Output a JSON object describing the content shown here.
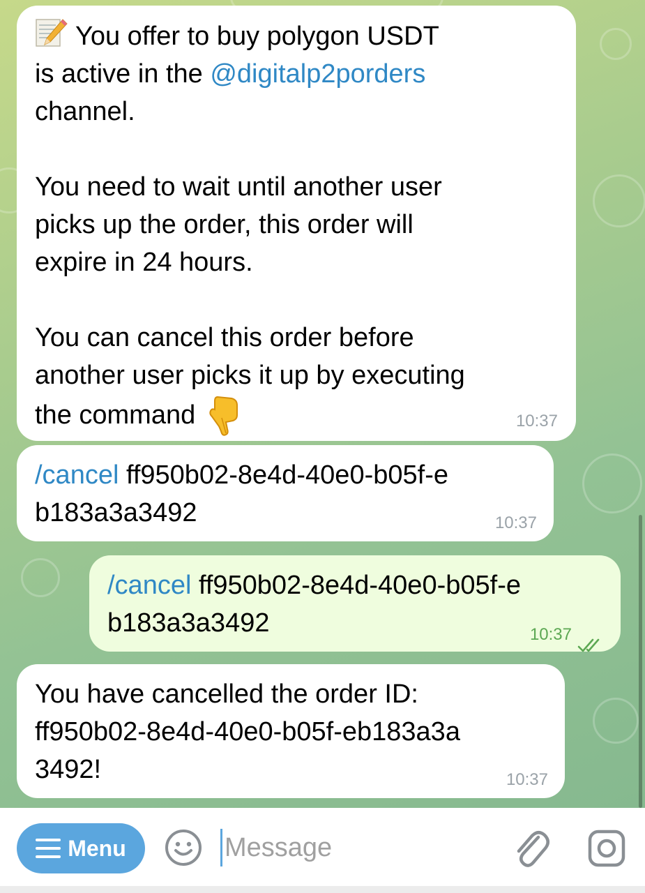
{
  "messages": [
    {
      "direction": "incoming",
      "line1": "You offer to buy polygon USDT",
      "line2_prefix": "is active in the ",
      "line2_link": "@digitalp2porders",
      "line3": "channel.",
      "line4": "You need to wait until another user",
      "line5": "picks up the order, this order will",
      "line6": "expire in 24 hours.",
      "line7": "You can cancel this order before",
      "line8": "another user picks it up by executing",
      "line9": "the command",
      "time": "10:37"
    },
    {
      "direction": "incoming",
      "command": "/cancel",
      "line1_rest": " ff950b02-8e4d-40e0-b05f-e",
      "line2": "b183a3a3492",
      "time": "10:37"
    },
    {
      "direction": "outgoing",
      "command": "/cancel",
      "line1_rest": " ff950b02-8e4d-40e0-b05f-e",
      "line2": "b183a3a3492",
      "time": "10:37",
      "status": "read"
    },
    {
      "direction": "incoming",
      "line1": "You have cancelled the order ID:",
      "line2": "ff950b02-8e4d-40e0-b05f-eb183a3a",
      "line3": "3492!",
      "time": "10:37"
    }
  ],
  "input_bar": {
    "menu_label": "Menu",
    "placeholder": "Message"
  },
  "colors": {
    "link": "#2f88c5",
    "menu_button": "#5ba6de",
    "outgoing_bubble": "#effdde",
    "read_check": "#5ca853"
  }
}
